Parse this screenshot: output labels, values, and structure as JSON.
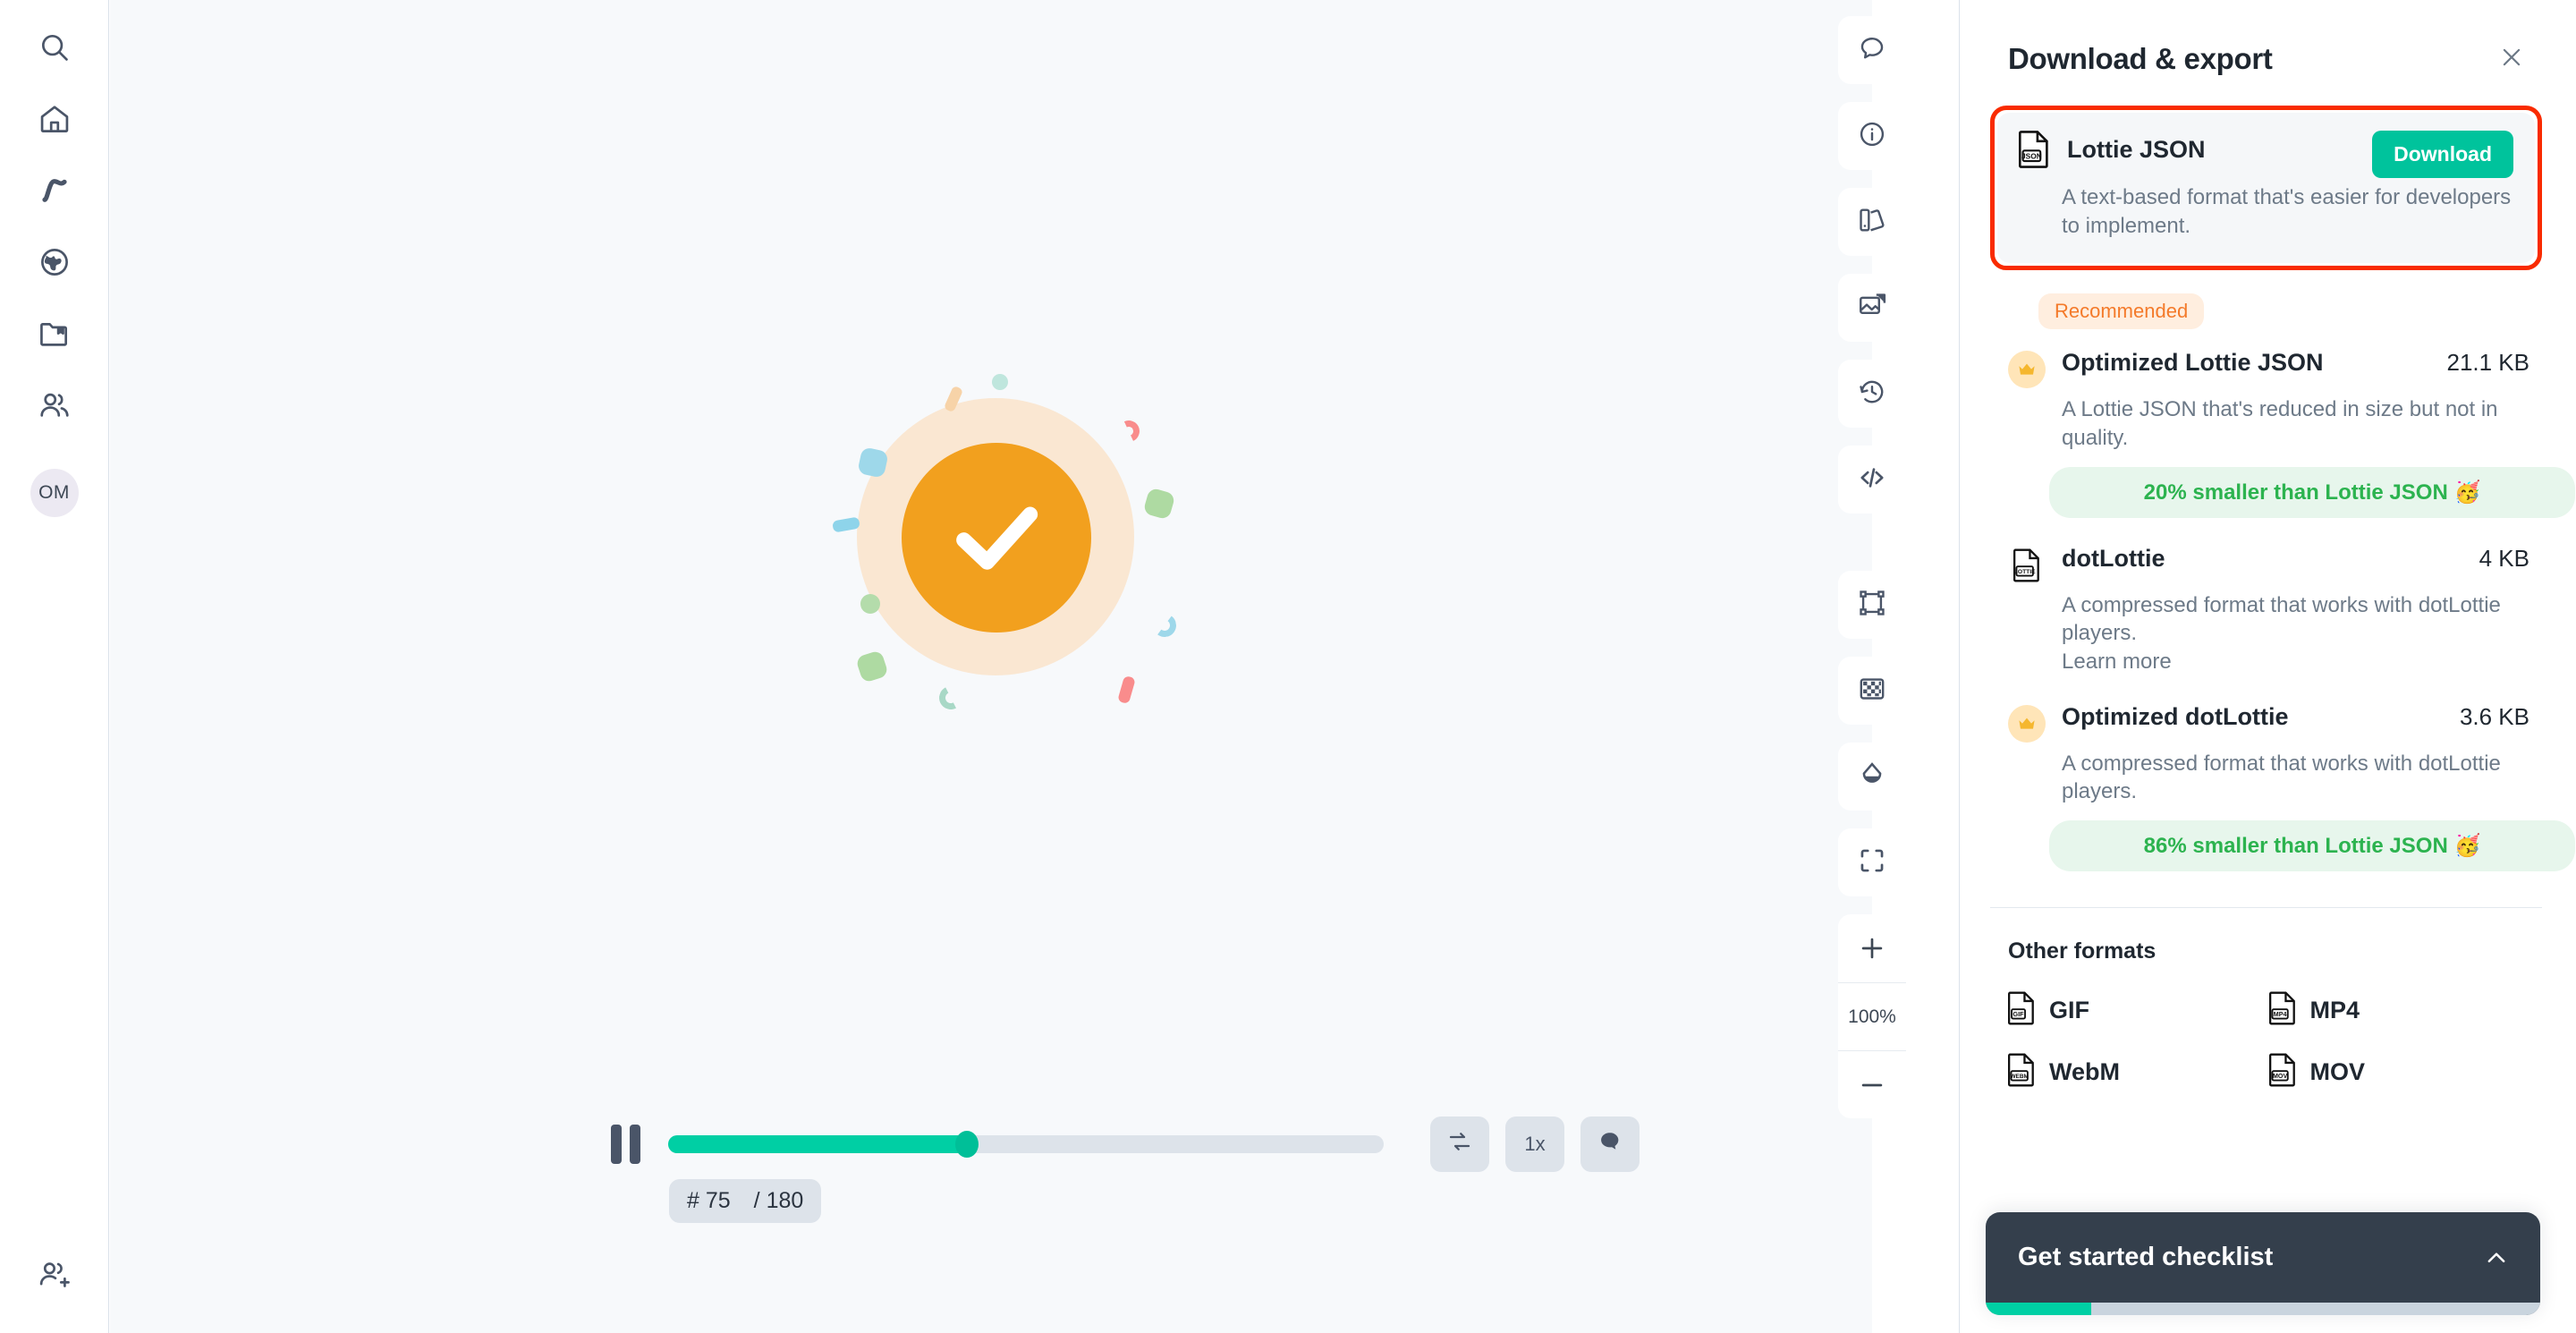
{
  "sidebar": {
    "items": [
      {
        "name": "search-icon",
        "label": "Search"
      },
      {
        "name": "home-icon",
        "label": "Home"
      },
      {
        "name": "curve-icon",
        "label": "Animations"
      },
      {
        "name": "globe-icon",
        "label": "Discover"
      },
      {
        "name": "folder-bookmark-icon",
        "label": "Workspace"
      },
      {
        "name": "users-icon",
        "label": "Teams"
      }
    ],
    "avatar_initials": "OM",
    "bottom_item": {
      "name": "add-user-icon",
      "label": "Invite"
    }
  },
  "canvas": {
    "animation_name": "success-check-animation"
  },
  "playback": {
    "state": "paused",
    "pause_label": "Pause",
    "progress_percent": 41.7,
    "frame_prefix": "# 75",
    "frame_total": "/ 180",
    "loop_label": "Loop",
    "speed_label": "1x",
    "comment_label": "Comment"
  },
  "toolbar": {
    "top_buttons": [
      {
        "name": "comment-icon",
        "label": "Comments"
      },
      {
        "name": "info-icon",
        "label": "Info"
      },
      {
        "name": "palette-icon",
        "label": "Colors"
      },
      {
        "name": "media-icon",
        "label": "Assets"
      },
      {
        "name": "history-icon",
        "label": "Version history"
      },
      {
        "name": "code-icon",
        "label": "Embed code"
      }
    ],
    "bottom_buttons": [
      {
        "name": "bounding-box-icon",
        "label": "Canvas size"
      },
      {
        "name": "checkerboard-icon",
        "label": "Transparency"
      },
      {
        "name": "theme-icon",
        "label": "Theme"
      },
      {
        "name": "fit-screen-icon",
        "label": "Fit to screen"
      }
    ],
    "zoom_in_label": "+",
    "zoom_level": "100%",
    "zoom_out_label": "—"
  },
  "panel": {
    "title": "Download & export",
    "close_label": "Close",
    "highlighted": {
      "icon": "json-file-icon",
      "name": "Lottie JSON",
      "description": "A text-based format that's easier for developers to implement.",
      "button_label": "Download"
    },
    "recommended_badge": "Recommended",
    "formats": [
      {
        "icon": "crown-icon",
        "name": "Optimized Lottie JSON",
        "size": "21.1 KB",
        "description": "A Lottie JSON that's reduced in size but not in quality.",
        "pill": "20% smaller than Lottie JSON 🥳",
        "learn_more": ""
      },
      {
        "icon": "lottie-file-icon",
        "name": "dotLottie",
        "size": "4 KB",
        "description": "A compressed format that works with dotLottie players.",
        "pill": "",
        "learn_more": "Learn more"
      },
      {
        "icon": "crown-icon",
        "name": "Optimized dotLottie",
        "size": "3.6 KB",
        "description": "A compressed format that works with dotLottie players.",
        "pill": "86% smaller than Lottie JSON 🥳",
        "learn_more": ""
      }
    ],
    "other_formats_heading": "Other formats",
    "other_formats": [
      {
        "icon": "gif-file-icon",
        "label": "GIF"
      },
      {
        "icon": "mp4-file-icon",
        "label": "MP4"
      },
      {
        "icon": "webm-file-icon",
        "label": "WebM"
      },
      {
        "icon": "mov-file-icon",
        "label": "MOV"
      }
    ]
  },
  "checklist": {
    "title": "Get started checklist",
    "caret": "chevron-up-icon",
    "progress_percent": 19
  },
  "colors": {
    "accent_teal": "#00c39c",
    "highlight_red": "#f92b00",
    "recommended_orange": "#f47a2a",
    "pill_green": "#2cb34f",
    "checklist_dark": "#343f4c",
    "animation_orange": "#f2a01e"
  }
}
